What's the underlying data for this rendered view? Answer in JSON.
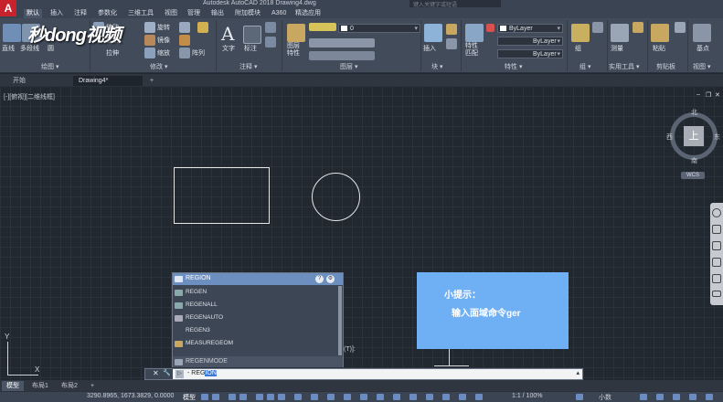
{
  "app": {
    "title": "Autodesk AutoCAD 2018    Drawing4.dwg",
    "search_placeholder": "键入关键字或短语",
    "logo": "A"
  },
  "watermark": "秒dong视频",
  "ribbon_tabs": [
    "默认",
    "插入",
    "注释",
    "参数化",
    "三维工具",
    "视图",
    "管理",
    "输出",
    "附加模块",
    "A360",
    "精选应用"
  ],
  "ribbon": {
    "draw": {
      "label": "绘图 ▾",
      "tools": [
        "直线",
        "多段线",
        "圆"
      ]
    },
    "modify": {
      "label": "修改 ▾",
      "tools": [
        "移动",
        "旋转",
        "复制",
        "镜像",
        "拉伸",
        "缩放",
        "阵列"
      ]
    },
    "annotation": {
      "label": "注释 ▾",
      "text": "文字",
      "dim": "标注"
    },
    "layers": {
      "label": "图层 ▾",
      "props": "图层\n特性",
      "layer_value": "0"
    },
    "block": {
      "label": "块 ▾",
      "insert": "插入"
    },
    "properties": {
      "label": "特性 ▾",
      "match": "特性\n匹配",
      "color": "ByLayer",
      "linetype": "ByLayer",
      "lineweight": "ByLayer"
    },
    "groups": {
      "label": "组 ▾",
      "group": "组"
    },
    "utilities": {
      "label": "实用工具 ▾",
      "measure": "测量"
    },
    "clipboard": {
      "label": "剪贴板",
      "paste": "粘贴"
    },
    "view": {
      "label": "视图 ▾",
      "base": "基点"
    }
  },
  "doc_tabs": {
    "start": "开始",
    "drawing": "Drawing4*",
    "add": "+"
  },
  "viewport": {
    "label": "[-][俯视][二维线框]"
  },
  "viewcube": {
    "north": "北",
    "south": "南",
    "east": "东",
    "west": "西",
    "face": "上",
    "wcs": "WCS"
  },
  "window_controls": {
    "minimize": "‒",
    "restore": "❐",
    "close": "✕"
  },
  "ucs": {
    "x": "X",
    "y": "Y"
  },
  "autocomplete": {
    "header": "REGION",
    "items": [
      "REGEN",
      "REGENALL",
      "REGENAUTO",
      "REGEN3",
      "MEASUREGEOM"
    ],
    "footer": "REGENMODE",
    "help_btn": "?",
    "settings_btn": "⚙"
  },
  "canvas_hint": "(T)]:",
  "tip": {
    "title": "小提示：",
    "body": "输入面域命令ger"
  },
  "command_line": {
    "close": "✕",
    "wrench": "🔧",
    "prompt_icon": "▷",
    "prefix": "- REG",
    "selected": "ION",
    "arrow": "▴"
  },
  "layout_tabs": [
    "模型",
    "布局1",
    "布局2",
    "+"
  ],
  "status": {
    "coords": "3290.8965, 1673.3829, 0.0000",
    "model": "模型",
    "scale": "1:1 / 100%",
    "units": "小数"
  }
}
